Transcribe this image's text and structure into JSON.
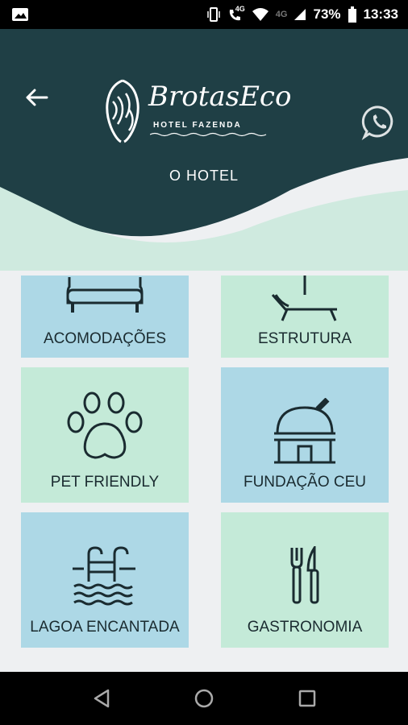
{
  "status_bar": {
    "network_label": "4G",
    "network_label_2": "4G",
    "battery": "73%",
    "time": "13:33"
  },
  "header": {
    "back_icon": "arrow-left-icon",
    "logo_text": "BrotasEco",
    "logo_subtitle": "HOTEL FAZENDA",
    "whatsapp_icon": "whatsapp-icon",
    "title": "O HOTEL"
  },
  "cards": [
    {
      "label": "ACOMODAÇÕES",
      "icon": "sofa-icon"
    },
    {
      "label": "ESTRUTURA",
      "icon": "sunbed-icon"
    },
    {
      "label": "PET FRIENDLY",
      "icon": "paw-icon"
    },
    {
      "label": "FUNDAÇÃO CEU",
      "icon": "observatory-icon"
    },
    {
      "label": "LAGOA ENCANTADA",
      "icon": "pool-icon"
    },
    {
      "label": "GASTRONOMIA",
      "icon": "fork-knife-icon"
    }
  ],
  "navbar": {
    "back": "nav-back-icon",
    "home": "nav-home-icon",
    "recents": "nav-recents-icon"
  },
  "colors": {
    "header_dark": "#1f3f45",
    "card_blue": "#add8e6",
    "card_green": "#c4ead8",
    "wave_light": "#cfeadf"
  }
}
